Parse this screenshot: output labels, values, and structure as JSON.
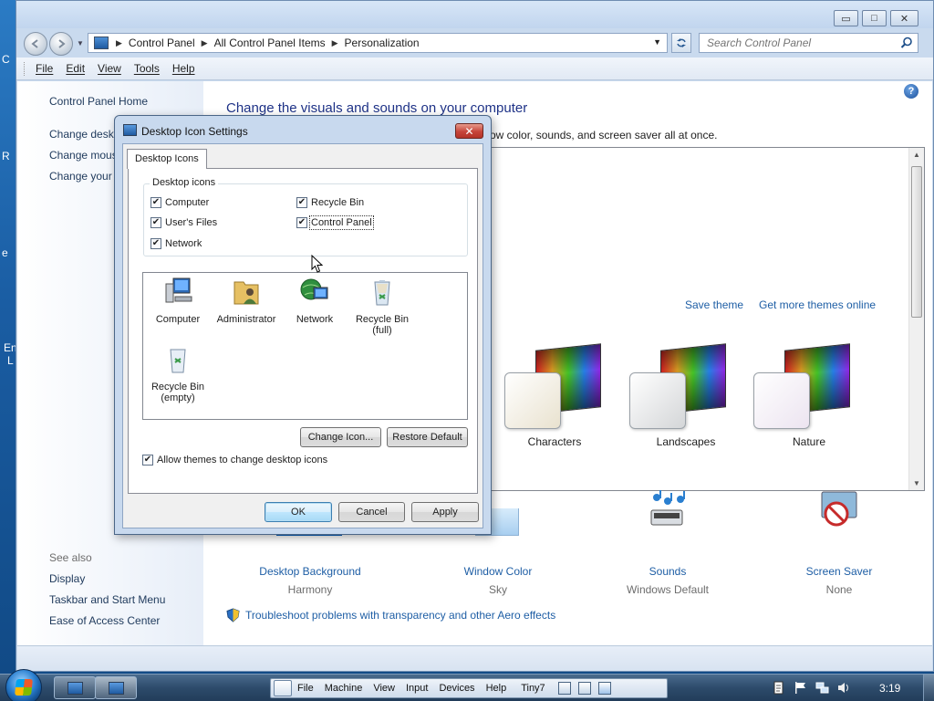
{
  "desktop": {
    "fragments": [
      "C",
      "R",
      "e",
      "En",
      "L"
    ]
  },
  "window": {
    "caption": {
      "minimize": "▭",
      "maximize": "□",
      "close": "✕"
    },
    "address": {
      "crumbs": [
        "Control Panel",
        "All Control Panel Items",
        "Personalization"
      ]
    },
    "search": {
      "placeholder": "Search Control Panel"
    },
    "menu": [
      "File",
      "Edit",
      "View",
      "Tools",
      "Help"
    ]
  },
  "leftpane": {
    "home": "Control Panel Home",
    "links": [
      "Change deskt",
      "Change mous",
      "Change your"
    ],
    "see_also_label": "See also",
    "see_also": [
      "Display",
      "Taskbar and Start Menu",
      "Ease of Access Center"
    ]
  },
  "main": {
    "title": "Change the visuals and sounds on your computer",
    "desc": "ow color, sounds, and screen saver all at once.",
    "save_theme": "Save theme",
    "get_more": "Get more themes online",
    "themes": [
      {
        "name": "Characters",
        "front_color": "#e9e2cf"
      },
      {
        "name": "Landscapes",
        "front_color": "#d4d6d8"
      },
      {
        "name": "Nature",
        "front_color": "#ece4f0"
      }
    ],
    "customize": [
      {
        "label": "Desktop Background",
        "sub": "Harmony"
      },
      {
        "label": "Window Color",
        "sub": "Sky"
      },
      {
        "label": "Sounds",
        "sub": "Windows Default"
      },
      {
        "label": "Screen Saver",
        "sub": "None"
      }
    ],
    "troubleshoot": "Troubleshoot problems with transparency and other Aero effects"
  },
  "dialog": {
    "title": "Desktop Icon Settings",
    "close": "✕",
    "tab": "Desktop Icons",
    "group_label": "Desktop icons",
    "checkboxes": [
      {
        "label": "Computer",
        "checked": true
      },
      {
        "label": "Recycle Bin",
        "checked": true
      },
      {
        "label": "User's Files",
        "checked": true
      },
      {
        "label": "Control Panel",
        "checked": true
      },
      {
        "label": "Network",
        "checked": true
      }
    ],
    "icons": [
      {
        "label": "Computer"
      },
      {
        "label": "Administrator"
      },
      {
        "label": "Network"
      },
      {
        "label": "Recycle Bin (full)"
      },
      {
        "label": "Recycle Bin (empty)"
      }
    ],
    "change_icon": "Change Icon...",
    "restore_default": "Restore Default",
    "allow_themes": "Allow themes to change desktop icons",
    "allow_themes_checked": true,
    "ok": "OK",
    "cancel": "Cancel",
    "apply": "Apply"
  },
  "taskbar": {
    "vm_menu": [
      "File",
      "Machine",
      "View",
      "Input",
      "Devices",
      "Help"
    ],
    "vm_name": "Tiny7",
    "clock": "3:19"
  }
}
